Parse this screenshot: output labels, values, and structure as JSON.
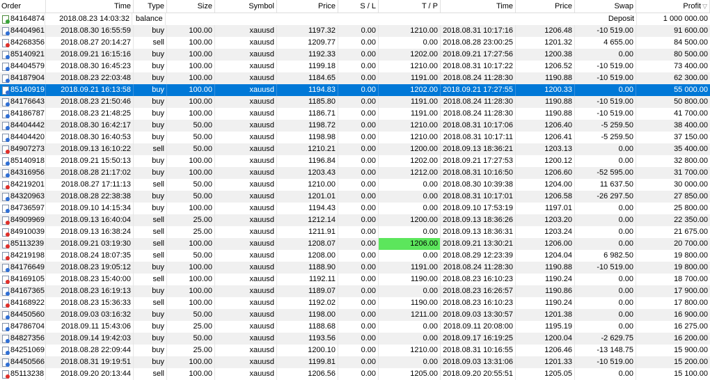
{
  "columns": [
    "Order",
    "Time",
    "Type",
    "Size",
    "Symbol",
    "Price",
    "S / L",
    "T / P",
    "Time",
    "Price",
    "Swap",
    "Profit"
  ],
  "sort_indicator": "▽",
  "balance_row": {
    "order": "84164874",
    "time": "2018.08.23 14:03:32",
    "type": "balance",
    "comment": "Deposit",
    "profit": "1 000 000.00",
    "icon": "balance-icon"
  },
  "rows": [
    {
      "order": "84404961",
      "time": "2018.08.30 16:55:59",
      "type": "buy",
      "size": "100.00",
      "symbol": "xauusd",
      "price": "1197.32",
      "sl": "0.00",
      "tp": "1210.00",
      "ctime": "2018.08.31 10:17:16",
      "cprice": "1206.48",
      "swap": "-10 519.00",
      "profit": "91 600.00"
    },
    {
      "order": "84268356",
      "time": "2018.08.27 20:14:27",
      "type": "sell",
      "size": "100.00",
      "symbol": "xauusd",
      "price": "1209.77",
      "sl": "0.00",
      "tp": "0.00",
      "ctime": "2018.08.28 23:00:25",
      "cprice": "1201.32",
      "swap": "4 655.00",
      "profit": "84 500.00"
    },
    {
      "order": "85140921",
      "time": "2018.09.21 16:15:16",
      "type": "buy",
      "size": "100.00",
      "symbol": "xauusd",
      "price": "1192.33",
      "sl": "0.00",
      "tp": "1202.00",
      "ctime": "2018.09.21 17:27:56",
      "cprice": "1200.38",
      "swap": "0.00",
      "profit": "80 500.00"
    },
    {
      "order": "84404579",
      "time": "2018.08.30 16:45:23",
      "type": "buy",
      "size": "100.00",
      "symbol": "xauusd",
      "price": "1199.18",
      "sl": "0.00",
      "tp": "1210.00",
      "ctime": "2018.08.31 10:17:22",
      "cprice": "1206.52",
      "swap": "-10 519.00",
      "profit": "73 400.00"
    },
    {
      "order": "84187904",
      "time": "2018.08.23 22:03:48",
      "type": "buy",
      "size": "100.00",
      "symbol": "xauusd",
      "price": "1184.65",
      "sl": "0.00",
      "tp": "1191.00",
      "ctime": "2018.08.24 11:28:30",
      "cprice": "1190.88",
      "swap": "-10 519.00",
      "profit": "62 300.00"
    },
    {
      "order": "85140919",
      "time": "2018.09.21 16:13:58",
      "type": "buy",
      "size": "100.00",
      "symbol": "xauusd",
      "price": "1194.83",
      "sl": "0.00",
      "tp": "1202.00",
      "ctime": "2018.09.21 17:27:55",
      "cprice": "1200.33",
      "swap": "0.00",
      "profit": "55 000.00",
      "selected": true
    },
    {
      "order": "84176643",
      "time": "2018.08.23 21:50:46",
      "type": "buy",
      "size": "100.00",
      "symbol": "xauusd",
      "price": "1185.80",
      "sl": "0.00",
      "tp": "1191.00",
      "ctime": "2018.08.24 11:28:30",
      "cprice": "1190.88",
      "swap": "-10 519.00",
      "profit": "50 800.00"
    },
    {
      "order": "84186787",
      "time": "2018.08.23 21:48:25",
      "type": "buy",
      "size": "100.00",
      "symbol": "xauusd",
      "price": "1186.71",
      "sl": "0.00",
      "tp": "1191.00",
      "ctime": "2018.08.24 11:28:30",
      "cprice": "1190.88",
      "swap": "-10 519.00",
      "profit": "41 700.00"
    },
    {
      "order": "84404442",
      "time": "2018.08.30 16:42:17",
      "type": "buy",
      "size": "50.00",
      "symbol": "xauusd",
      "price": "1198.72",
      "sl": "0.00",
      "tp": "1210.00",
      "ctime": "2018.08.31 10:17:06",
      "cprice": "1206.40",
      "swap": "-5 259.50",
      "profit": "38 400.00"
    },
    {
      "order": "84404420",
      "time": "2018.08.30 16:40:53",
      "type": "buy",
      "size": "50.00",
      "symbol": "xauusd",
      "price": "1198.98",
      "sl": "0.00",
      "tp": "1210.00",
      "ctime": "2018.08.31 10:17:11",
      "cprice": "1206.41",
      "swap": "-5 259.50",
      "profit": "37 150.00"
    },
    {
      "order": "84907273",
      "time": "2018.09.13 16:10:22",
      "type": "sell",
      "size": "50.00",
      "symbol": "xauusd",
      "price": "1210.21",
      "sl": "0.00",
      "tp": "1200.00",
      "ctime": "2018.09.13 18:36:21",
      "cprice": "1203.13",
      "swap": "0.00",
      "profit": "35 400.00"
    },
    {
      "order": "85140918",
      "time": "2018.09.21 15:50:13",
      "type": "buy",
      "size": "100.00",
      "symbol": "xauusd",
      "price": "1196.84",
      "sl": "0.00",
      "tp": "1202.00",
      "ctime": "2018.09.21 17:27:53",
      "cprice": "1200.12",
      "swap": "0.00",
      "profit": "32 800.00"
    },
    {
      "order": "84316956",
      "time": "2018.08.28 21:17:02",
      "type": "buy",
      "size": "100.00",
      "symbol": "xauusd",
      "price": "1203.43",
      "sl": "0.00",
      "tp": "1212.00",
      "ctime": "2018.08.31 10:16:50",
      "cprice": "1206.60",
      "swap": "-52 595.00",
      "profit": "31 700.00"
    },
    {
      "order": "84219201",
      "time": "2018.08.27 17:11:13",
      "type": "sell",
      "size": "50.00",
      "symbol": "xauusd",
      "price": "1210.00",
      "sl": "0.00",
      "tp": "0.00",
      "ctime": "2018.08.30 10:39:38",
      "cprice": "1204.00",
      "swap": "11 637.50",
      "profit": "30 000.00"
    },
    {
      "order": "84320963",
      "time": "2018.08.28 22:38:38",
      "type": "buy",
      "size": "50.00",
      "symbol": "xauusd",
      "price": "1201.01",
      "sl": "0.00",
      "tp": "0.00",
      "ctime": "2018.08.31 10:17:01",
      "cprice": "1206.58",
      "swap": "-26 297.50",
      "profit": "27 850.00"
    },
    {
      "order": "84736597",
      "time": "2018.09.10 14:15:34",
      "type": "buy",
      "size": "100.00",
      "symbol": "xauusd",
      "price": "1194.43",
      "sl": "0.00",
      "tp": "0.00",
      "ctime": "2018.09.10 17:53:19",
      "cprice": "1197.01",
      "swap": "0.00",
      "profit": "25 800.00"
    },
    {
      "order": "84909969",
      "time": "2018.09.13 16:40:04",
      "type": "sell",
      "size": "25.00",
      "symbol": "xauusd",
      "price": "1212.14",
      "sl": "0.00",
      "tp": "1200.00",
      "ctime": "2018.09.13 18:36:26",
      "cprice": "1203.20",
      "swap": "0.00",
      "profit": "22 350.00"
    },
    {
      "order": "84910039",
      "time": "2018.09.13 16:38:24",
      "type": "sell",
      "size": "25.00",
      "symbol": "xauusd",
      "price": "1211.91",
      "sl": "0.00",
      "tp": "0.00",
      "ctime": "2018.09.13 18:36:31",
      "cprice": "1203.24",
      "swap": "0.00",
      "profit": "21 675.00"
    },
    {
      "order": "85113239",
      "time": "2018.09.21 03:19:30",
      "type": "sell",
      "size": "100.00",
      "symbol": "xauusd",
      "price": "1208.07",
      "sl": "0.00",
      "tp": "1206.00",
      "ctime": "2018.09.21 13:30:21",
      "cprice": "1206.00",
      "swap": "0.00",
      "profit": "20 700.00",
      "tp_highlight": true
    },
    {
      "order": "84219198",
      "time": "2018.08.24 18:07:35",
      "type": "sell",
      "size": "50.00",
      "symbol": "xauusd",
      "price": "1208.00",
      "sl": "0.00",
      "tp": "0.00",
      "ctime": "2018.08.29 12:23:39",
      "cprice": "1204.04",
      "swap": "6 982.50",
      "profit": "19 800.00"
    },
    {
      "order": "84176649",
      "time": "2018.08.23 19:05:12",
      "type": "buy",
      "size": "100.00",
      "symbol": "xauusd",
      "price": "1188.90",
      "sl": "0.00",
      "tp": "1191.00",
      "ctime": "2018.08.24 11:28:30",
      "cprice": "1190.88",
      "swap": "-10 519.00",
      "profit": "19 800.00"
    },
    {
      "order": "84169105",
      "time": "2018.08.23 15:40:00",
      "type": "sell",
      "size": "100.00",
      "symbol": "xauusd",
      "price": "1192.11",
      "sl": "0.00",
      "tp": "1190.00",
      "ctime": "2018.08.23 16:10:23",
      "cprice": "1190.24",
      "swap": "0.00",
      "profit": "18 700.00"
    },
    {
      "order": "84167365",
      "time": "2018.08.23 16:19:13",
      "type": "buy",
      "size": "100.00",
      "symbol": "xauusd",
      "price": "1189.07",
      "sl": "0.00",
      "tp": "0.00",
      "ctime": "2018.08.23 16:26:57",
      "cprice": "1190.86",
      "swap": "0.00",
      "profit": "17 900.00"
    },
    {
      "order": "84168922",
      "time": "2018.08.23 15:36:33",
      "type": "sell",
      "size": "100.00",
      "symbol": "xauusd",
      "price": "1192.02",
      "sl": "0.00",
      "tp": "1190.00",
      "ctime": "2018.08.23 16:10:23",
      "cprice": "1190.24",
      "swap": "0.00",
      "profit": "17 800.00"
    },
    {
      "order": "84450560",
      "time": "2018.09.03 03:16:32",
      "type": "buy",
      "size": "50.00",
      "symbol": "xauusd",
      "price": "1198.00",
      "sl": "0.00",
      "tp": "1211.00",
      "ctime": "2018.09.03 13:30:57",
      "cprice": "1201.38",
      "swap": "0.00",
      "profit": "16 900.00"
    },
    {
      "order": "84786704",
      "time": "2018.09.11 15:43:06",
      "type": "buy",
      "size": "25.00",
      "symbol": "xauusd",
      "price": "1188.68",
      "sl": "0.00",
      "tp": "0.00",
      "ctime": "2018.09.11 20:08:00",
      "cprice": "1195.19",
      "swap": "0.00",
      "profit": "16 275.00"
    },
    {
      "order": "84827356",
      "time": "2018.09.14 19:42:03",
      "type": "buy",
      "size": "50.00",
      "symbol": "xauusd",
      "price": "1193.56",
      "sl": "0.00",
      "tp": "0.00",
      "ctime": "2018.09.17 16:19:25",
      "cprice": "1200.04",
      "swap": "-2 629.75",
      "profit": "16 200.00"
    },
    {
      "order": "84251069",
      "time": "2018.08.28 22:09:44",
      "type": "buy",
      "size": "25.00",
      "symbol": "xauusd",
      "price": "1200.10",
      "sl": "0.00",
      "tp": "1210.00",
      "ctime": "2018.08.31 10:16:55",
      "cprice": "1206.46",
      "swap": "-13 148.75",
      "profit": "15 900.00"
    },
    {
      "order": "84450566",
      "time": "2018.08.31 19:19:51",
      "type": "buy",
      "size": "100.00",
      "symbol": "xauusd",
      "price": "1199.81",
      "sl": "0.00",
      "tp": "0.00",
      "ctime": "2018.09.03 13:31:06",
      "cprice": "1201.33",
      "swap": "-10 519.00",
      "profit": "15 200.00"
    },
    {
      "order": "85113238",
      "time": "2018.09.20 20:13:44",
      "type": "sell",
      "size": "100.00",
      "symbol": "xauusd",
      "price": "1206.56",
      "sl": "0.00",
      "tp": "1205.00",
      "ctime": "2018.09.20 20:55:51",
      "cprice": "1205.05",
      "swap": "0.00",
      "profit": "15 100.00"
    }
  ],
  "colors": {
    "selection": "#0078d7",
    "tp_highlight": "#5ce65c",
    "alt_row": "#f0f0f0",
    "buy_icon": "#2f6fd6",
    "sell_icon": "#e0302a",
    "balance_icon": "#3aa53a"
  }
}
